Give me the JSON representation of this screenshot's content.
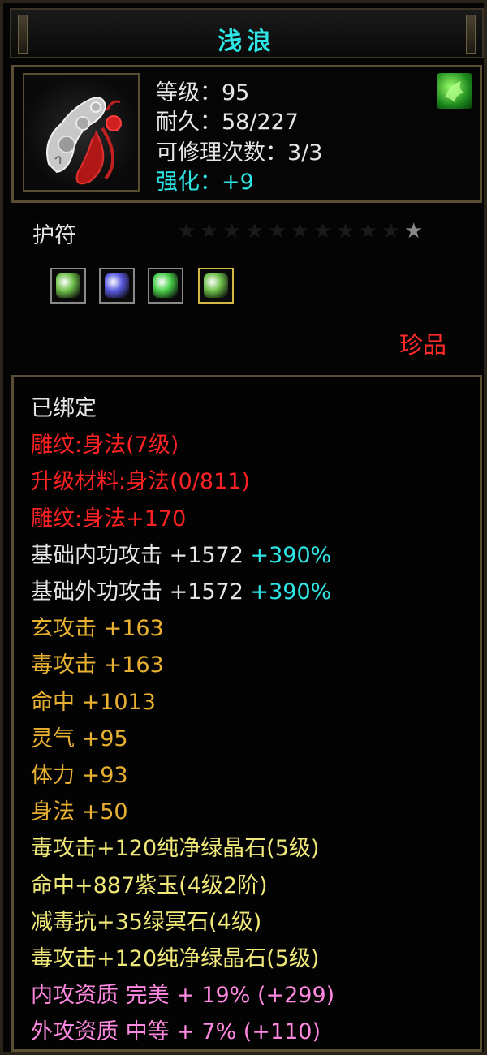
{
  "item": {
    "name": "浅浪",
    "level": "等级：95",
    "durability": "耐久：58/227",
    "repair": "可修理次数：3/3",
    "enhance": "强化：+9",
    "type": "护符",
    "quality": "珍品",
    "stars_filled": 0,
    "stars_total": 10
  },
  "sockets": [
    {
      "gem": "green-jade-gem",
      "color": "#6fbf4a",
      "selected": false
    },
    {
      "gem": "purple-jade-gem",
      "color": "#5a5ae0",
      "selected": false
    },
    {
      "gem": "green-crystal-gem",
      "color": "#4ad04a",
      "selected": false
    },
    {
      "gem": "green-jade-gem",
      "color": "#6fbf4a",
      "selected": true
    }
  ],
  "attributes": [
    {
      "text": "已绑定",
      "color": "white"
    },
    {
      "text": "雕纹:身法(7级)",
      "color": "red"
    },
    {
      "text": "升级材料:身法(0/811)",
      "color": "red"
    },
    {
      "text": "雕纹:身法+170",
      "color": "red"
    },
    {
      "text": "基础内功攻击 +1572",
      "extra": "+390%",
      "color": "white"
    },
    {
      "text": "基础外功攻击 +1572",
      "extra": "+390%",
      "color": "white"
    },
    {
      "text": "玄攻击 +163",
      "color": "orange"
    },
    {
      "text": "毒攻击 +163",
      "color": "orange"
    },
    {
      "text": "命中 +1013",
      "color": "orange"
    },
    {
      "text": "灵气 +95",
      "color": "orange"
    },
    {
      "text": "体力 +93",
      "color": "orange"
    },
    {
      "text": "身法 +50",
      "color": "orange"
    },
    {
      "text": "毒攻击+120纯净绿晶石(5级)",
      "color": "ltyellow"
    },
    {
      "text": "命中+887紫玉(4级2阶)",
      "color": "ltyellow"
    },
    {
      "text": "减毒抗+35绿冥石(4级)",
      "color": "ltyellow"
    },
    {
      "text": "毒攻击+120纯净绿晶石(5级)",
      "color": "ltyellow"
    },
    {
      "text": "内攻资质 完美 + 19% (+299)",
      "color": "pink"
    },
    {
      "text": "外攻资质 中等 + 7% (+110)",
      "color": "pink"
    }
  ],
  "colors": {
    "title": "#2ee6e6",
    "quality": "#ff2a2a",
    "border": "#5a4e32"
  }
}
